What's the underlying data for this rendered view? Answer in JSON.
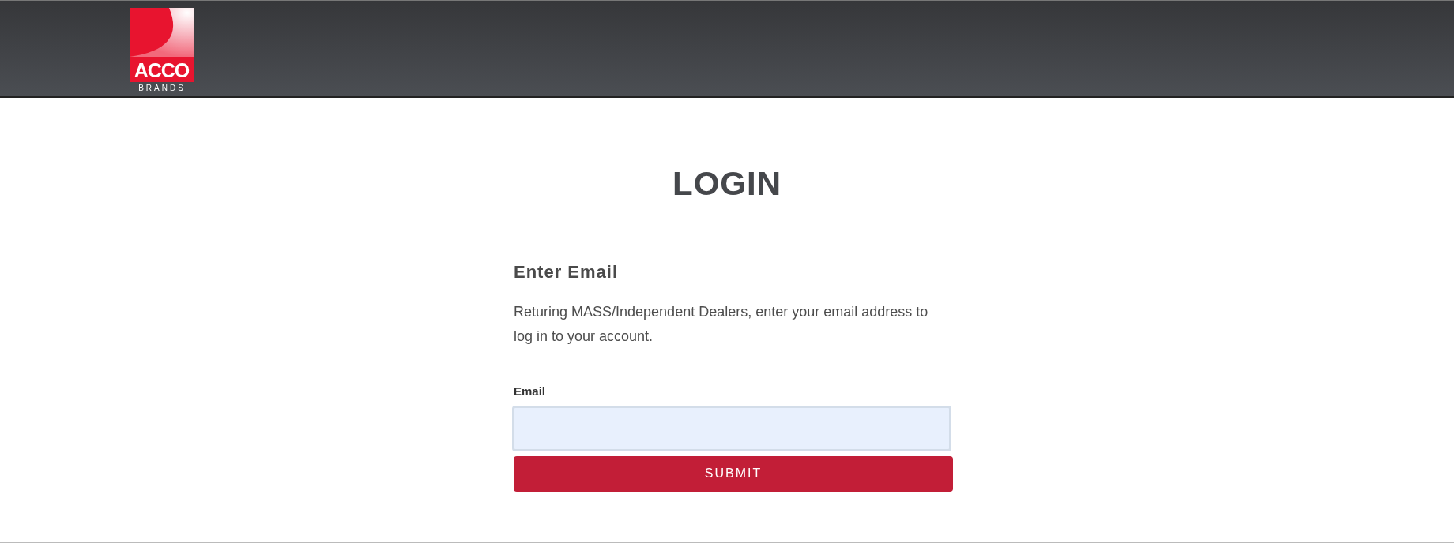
{
  "header": {
    "logo": {
      "wordmark": "ACCO",
      "subtitle": "BRANDS"
    }
  },
  "title": "LOGIN",
  "form": {
    "heading": "Enter Email",
    "description": "Returing MASS/Independent Dealers, enter your email address to log in to your account.",
    "email_label": "Email",
    "submit": "SUBMIT"
  }
}
